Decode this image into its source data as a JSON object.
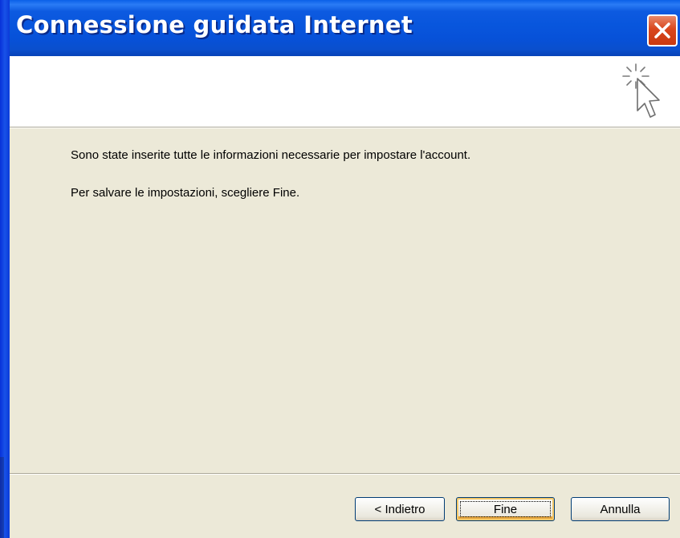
{
  "window": {
    "title": "Connessione guidata Internet"
  },
  "header": {
    "icon": "wizard-cursor-sparkle-icon"
  },
  "content": {
    "message_1": "Sono state inserite tutte le informazioni necessarie per impostare l'account.",
    "message_2": "Per salvare le impostazioni, scegliere Fine."
  },
  "buttons": {
    "back_label": "< Indietro",
    "finish_label": "Fine",
    "cancel_label": "Annulla"
  },
  "colors": {
    "titlebar": "#0856dd",
    "dialog_background": "#ece9d8",
    "close_button": "#d9461d"
  }
}
